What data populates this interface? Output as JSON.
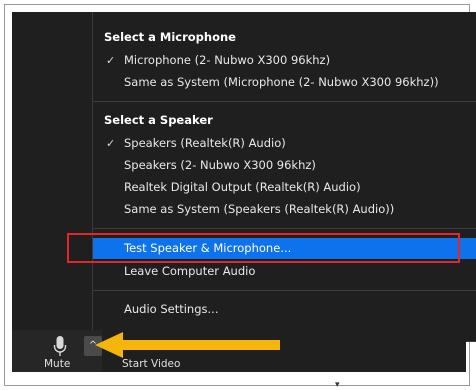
{
  "menu": {
    "microphone_header": "Select a Microphone",
    "microphones": [
      {
        "label": "Microphone (2- Nubwo X300  96khz)",
        "checked": true
      },
      {
        "label": "Same as System (Microphone (2- Nubwo X300  96khz))",
        "checked": false
      }
    ],
    "speaker_header": "Select a Speaker",
    "speakers": [
      {
        "label": "Speakers (Realtek(R) Audio)",
        "checked": true
      },
      {
        "label": "Speakers (2- Nubwo X300  96khz)",
        "checked": false
      },
      {
        "label": "Realtek Digital Output (Realtek(R) Audio)",
        "checked": false
      },
      {
        "label": "Same as System (Speakers (Realtek(R) Audio))",
        "checked": false
      }
    ],
    "test_label": "Test Speaker & Microphone...",
    "leave_label": "Leave Computer Audio",
    "settings_label": "Audio Settings...",
    "check_glyph": "✓"
  },
  "toolbar": {
    "mute_label": "Mute",
    "start_video_label": "Start Video",
    "caret_glyph": "^"
  },
  "colors": {
    "highlight": "#0e72ed",
    "annotation_box": "#e12727",
    "annotation_arrow": "#f5b50a",
    "menu_bg": "#1f1f1f"
  },
  "icons": [
    "check-icon",
    "microphone-icon",
    "caret-up-icon",
    "arrow-left-icon"
  ]
}
